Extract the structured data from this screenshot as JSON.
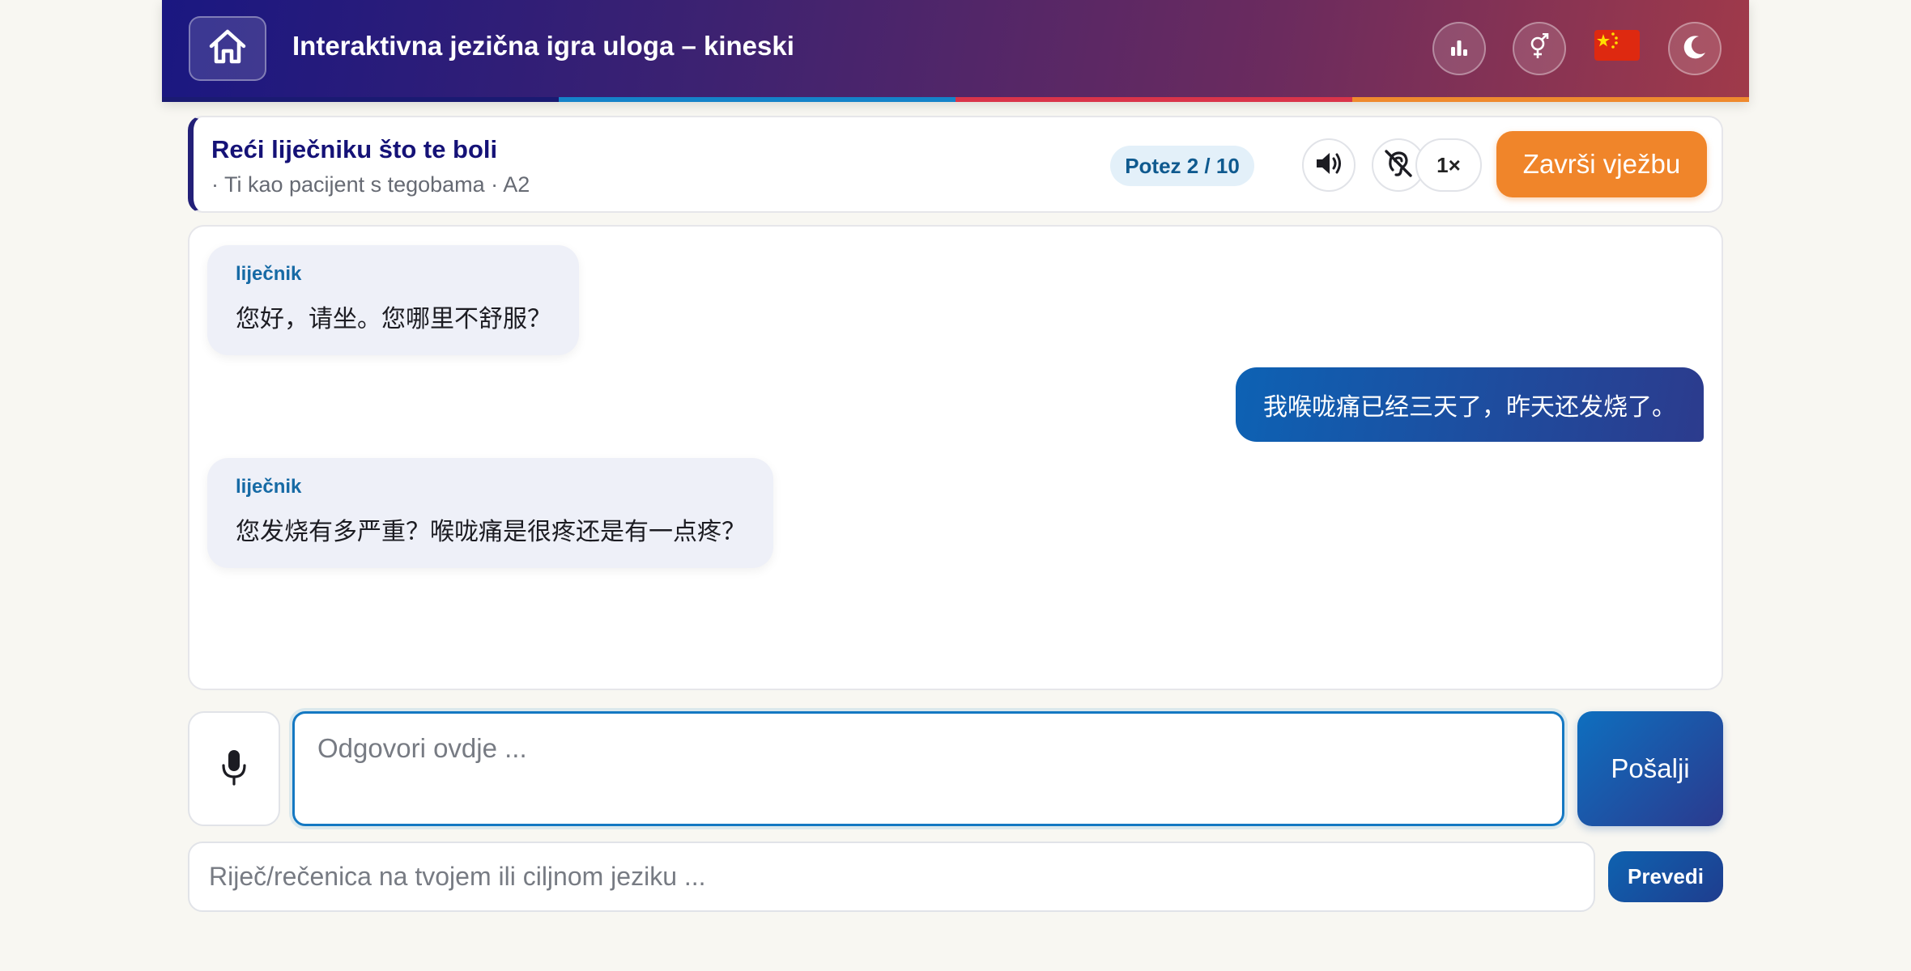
{
  "header": {
    "title": "Interaktivna jezična igra uloga – kineski",
    "icons": {
      "home": "home-icon",
      "stats": "bar-chart-icon",
      "gender": "gender-icon",
      "language_flag": "china-flag-icon",
      "theme": "moon-icon"
    },
    "stripe_colors": [
      "#1a1a72",
      "#1583c9",
      "#d9344a",
      "#ef8a2e"
    ],
    "gradient": [
      "#1a1781",
      "#a03a4a"
    ]
  },
  "scenario": {
    "title": "Reći liječniku što te boli",
    "subtitle": "· Ti kao pacijent s tegobama · A2",
    "turn": "Potez 2 / 10",
    "speed": "1×",
    "finish_label": "Završi vježbu",
    "icons": {
      "audio": "speaker-icon",
      "mute": "muted-ear-icon"
    },
    "accent": "#f0852a"
  },
  "chat": {
    "messages": [
      {
        "role": "partner",
        "speaker": "liječnik",
        "text": "您好，请坐。您哪里不舒服？"
      },
      {
        "role": "user",
        "text": "我喉咙痛已经三天了，昨天还发烧了。"
      },
      {
        "role": "partner",
        "speaker": "liječnik",
        "text": "您发烧有多严重？喉咙痛是很疼还是有一点疼？"
      }
    ]
  },
  "composer": {
    "mic_icon": "microphone-icon",
    "answer_placeholder": "Odgovori ovdje ...",
    "send_label": "Pošalji",
    "translate_placeholder": "Riječ/rečenica na tvojem ili ciljnom jeziku ...",
    "translate_label": "Prevedi"
  }
}
